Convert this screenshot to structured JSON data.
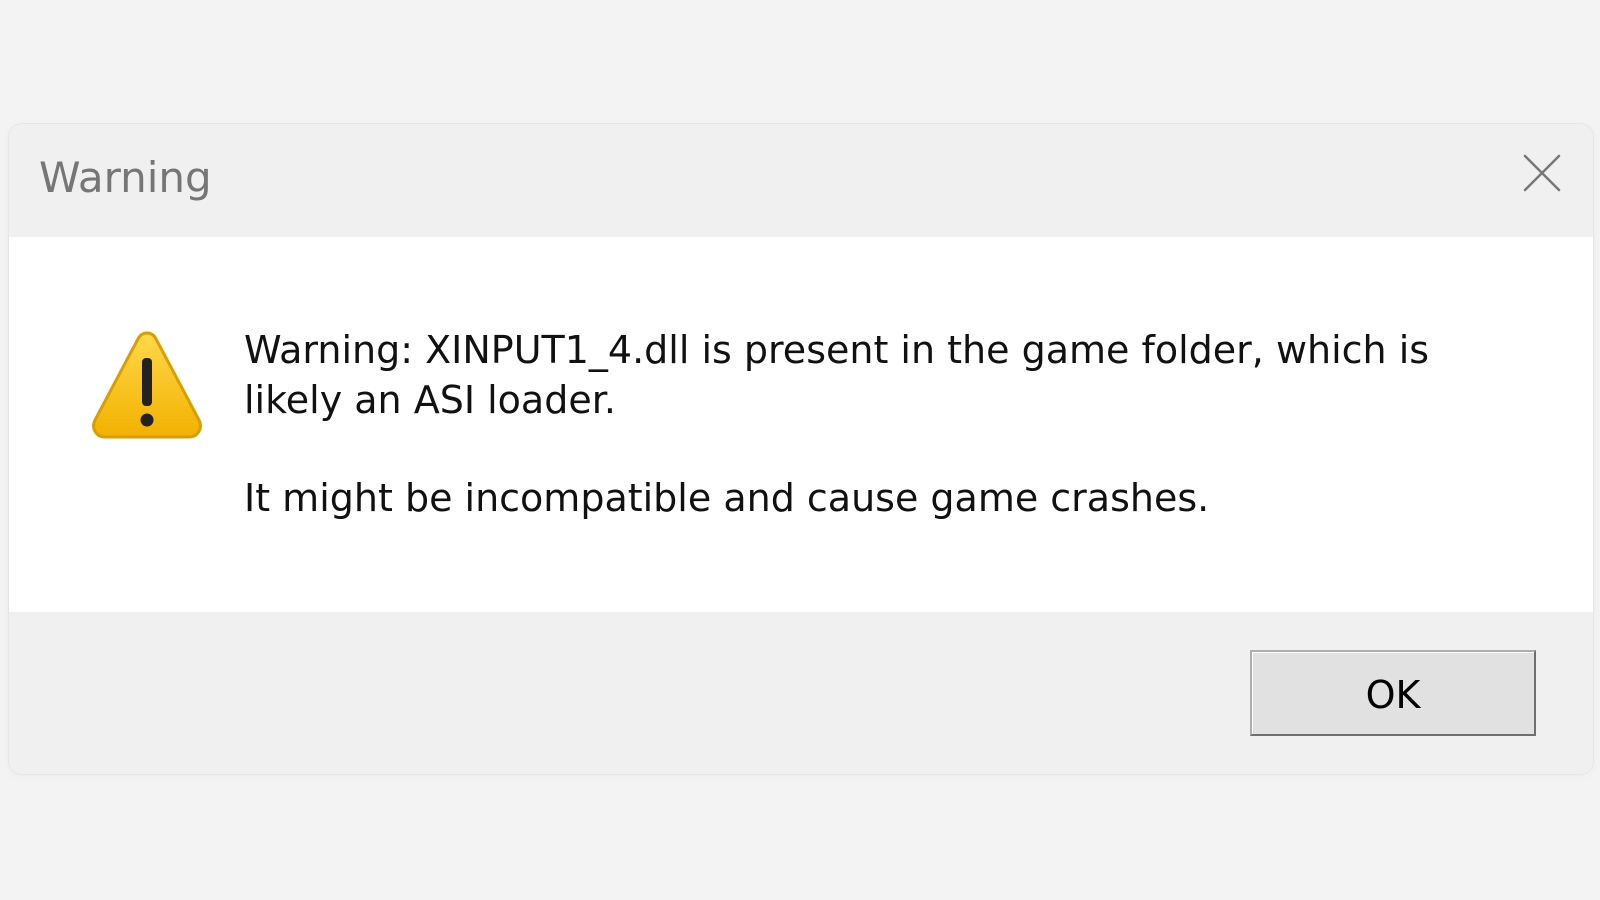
{
  "window": {
    "title": "Warning",
    "close_icon": "close-icon"
  },
  "message": {
    "line1": "Warning: XINPUT1_4.dll is present in the game folder, which is likely an ASI loader.",
    "line2": "It might be incompatible and cause game crashes."
  },
  "icon": {
    "name": "warning-icon",
    "accent": "#f2b600",
    "outline": "#d99a00"
  },
  "buttons": {
    "ok_label": "OK"
  },
  "colors": {
    "background": "#f3f3f3",
    "content": "#ffffff",
    "titlebar": "#f0f0f0"
  }
}
